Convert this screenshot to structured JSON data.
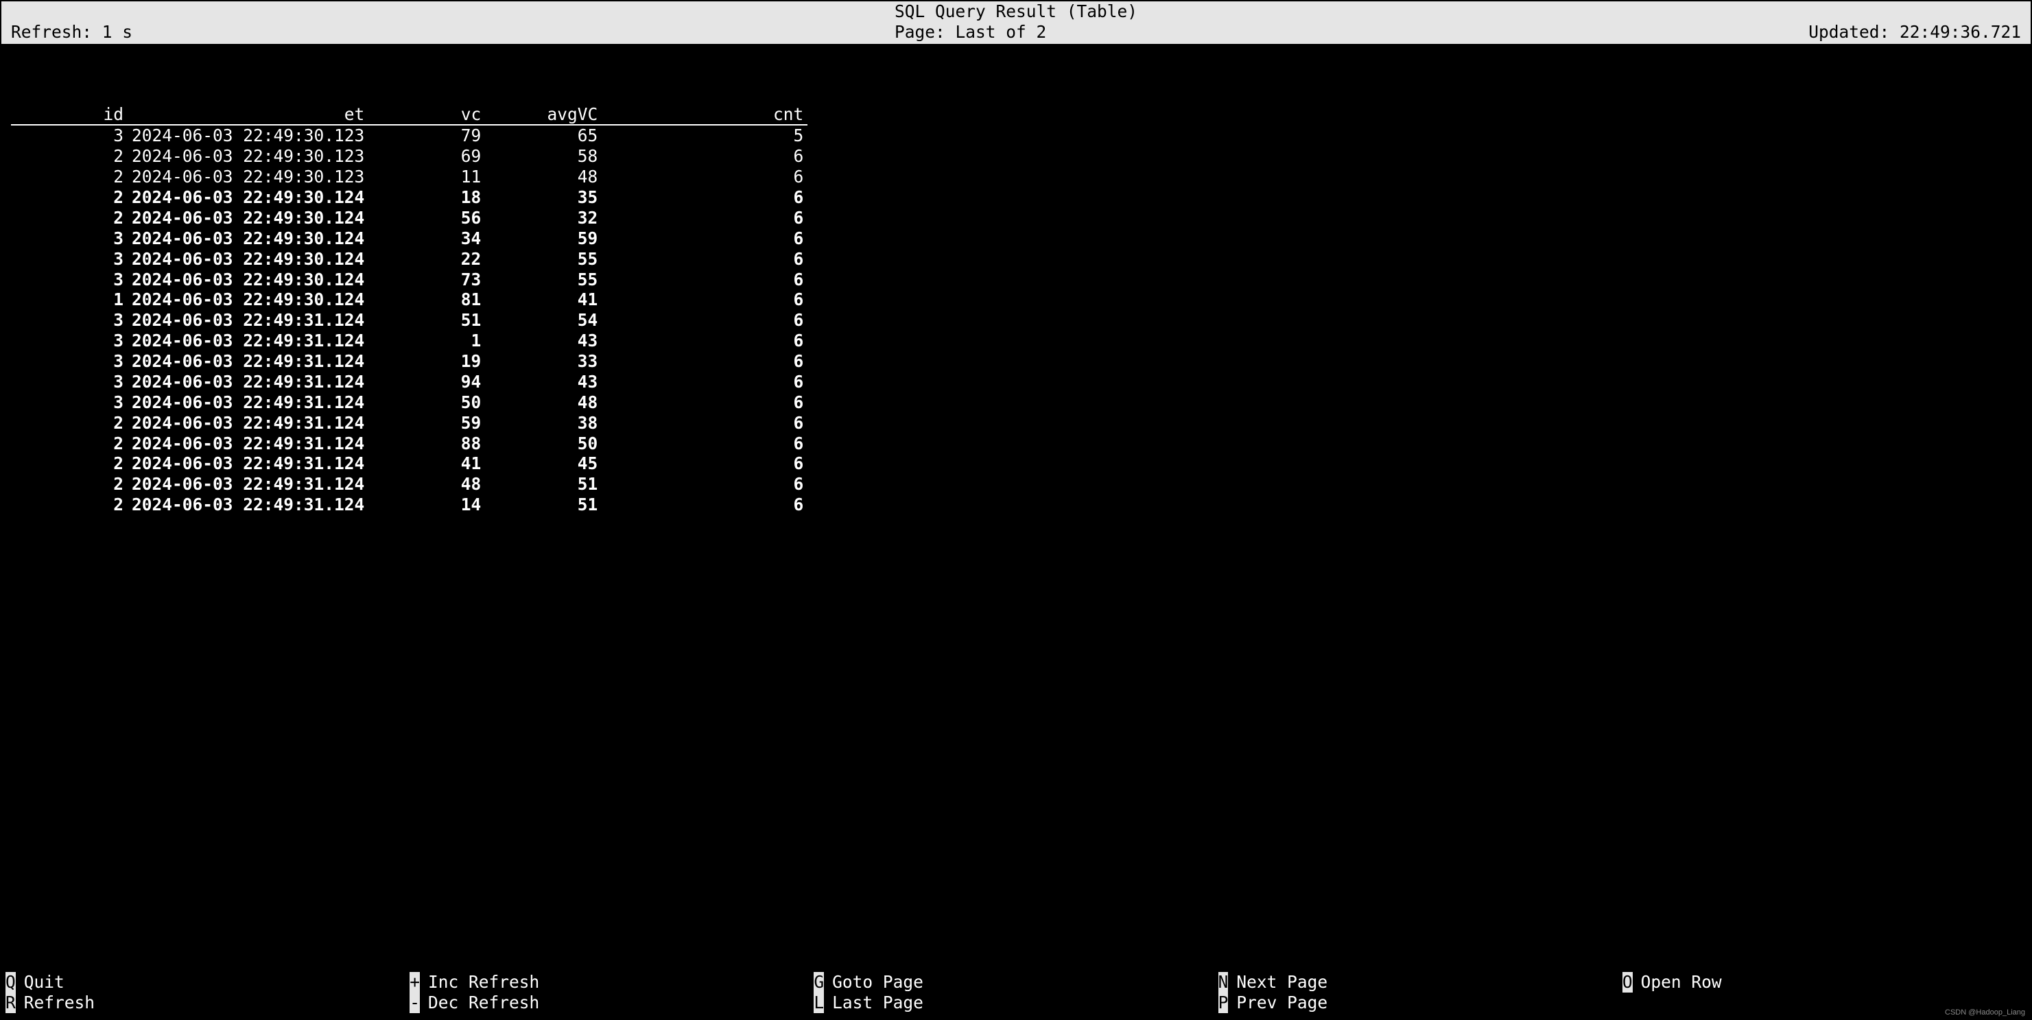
{
  "header": {
    "title": "SQL Query Result (Table)",
    "refresh_label": "Refresh: 1 s",
    "page_label": "Page: Last of 2",
    "updated_label": "Updated: 22:49:36.721"
  },
  "columns": [
    "id",
    "et",
    "vc",
    "avgVC",
    "cnt"
  ],
  "rows": [
    {
      "id": "3",
      "et": "2024-06-03 22:49:30.123",
      "vc": "79",
      "avg": "65",
      "cnt": "5",
      "bold": false
    },
    {
      "id": "2",
      "et": "2024-06-03 22:49:30.123",
      "vc": "69",
      "avg": "58",
      "cnt": "6",
      "bold": false
    },
    {
      "id": "2",
      "et": "2024-06-03 22:49:30.123",
      "vc": "11",
      "avg": "48",
      "cnt": "6",
      "bold": false
    },
    {
      "id": "2",
      "et": "2024-06-03 22:49:30.124",
      "vc": "18",
      "avg": "35",
      "cnt": "6",
      "bold": true
    },
    {
      "id": "2",
      "et": "2024-06-03 22:49:30.124",
      "vc": "56",
      "avg": "32",
      "cnt": "6",
      "bold": true
    },
    {
      "id": "3",
      "et": "2024-06-03 22:49:30.124",
      "vc": "34",
      "avg": "59",
      "cnt": "6",
      "bold": true
    },
    {
      "id": "3",
      "et": "2024-06-03 22:49:30.124",
      "vc": "22",
      "avg": "55",
      "cnt": "6",
      "bold": true
    },
    {
      "id": "3",
      "et": "2024-06-03 22:49:30.124",
      "vc": "73",
      "avg": "55",
      "cnt": "6",
      "bold": true
    },
    {
      "id": "1",
      "et": "2024-06-03 22:49:30.124",
      "vc": "81",
      "avg": "41",
      "cnt": "6",
      "bold": true
    },
    {
      "id": "3",
      "et": "2024-06-03 22:49:31.124",
      "vc": "51",
      "avg": "54",
      "cnt": "6",
      "bold": true
    },
    {
      "id": "3",
      "et": "2024-06-03 22:49:31.124",
      "vc": "1",
      "avg": "43",
      "cnt": "6",
      "bold": true
    },
    {
      "id": "3",
      "et": "2024-06-03 22:49:31.124",
      "vc": "19",
      "avg": "33",
      "cnt": "6",
      "bold": true
    },
    {
      "id": "3",
      "et": "2024-06-03 22:49:31.124",
      "vc": "94",
      "avg": "43",
      "cnt": "6",
      "bold": true
    },
    {
      "id": "3",
      "et": "2024-06-03 22:49:31.124",
      "vc": "50",
      "avg": "48",
      "cnt": "6",
      "bold": true
    },
    {
      "id": "2",
      "et": "2024-06-03 22:49:31.124",
      "vc": "59",
      "avg": "38",
      "cnt": "6",
      "bold": true
    },
    {
      "id": "2",
      "et": "2024-06-03 22:49:31.124",
      "vc": "88",
      "avg": "50",
      "cnt": "6",
      "bold": true
    },
    {
      "id": "2",
      "et": "2024-06-03 22:49:31.124",
      "vc": "41",
      "avg": "45",
      "cnt": "6",
      "bold": true
    },
    {
      "id": "2",
      "et": "2024-06-03 22:49:31.124",
      "vc": "48",
      "avg": "51",
      "cnt": "6",
      "bold": true
    },
    {
      "id": "2",
      "et": "2024-06-03 22:49:31.124",
      "vc": "14",
      "avg": "51",
      "cnt": "6",
      "bold": true
    }
  ],
  "footer": {
    "groups": [
      [
        {
          "key": "Q",
          "label": "Quit"
        },
        {
          "key": "R",
          "label": "Refresh"
        }
      ],
      [
        {
          "key": "+",
          "label": "Inc Refresh"
        },
        {
          "key": "-",
          "label": "Dec Refresh"
        }
      ],
      [
        {
          "key": "G",
          "label": "Goto Page"
        },
        {
          "key": "L",
          "label": "Last Page"
        }
      ],
      [
        {
          "key": "N",
          "label": "Next Page"
        },
        {
          "key": "P",
          "label": "Prev Page"
        }
      ],
      [
        {
          "key": "O",
          "label": "Open Row"
        }
      ]
    ]
  },
  "watermark": "CSDN @Hadoop_Liang",
  "chart_data": {
    "type": "table",
    "title": "SQL Query Result (Table)",
    "columns": [
      "id",
      "et",
      "vc",
      "avgVC",
      "cnt"
    ],
    "data": [
      [
        3,
        "2024-06-03 22:49:30.123",
        79,
        65,
        5
      ],
      [
        2,
        "2024-06-03 22:49:30.123",
        69,
        58,
        6
      ],
      [
        2,
        "2024-06-03 22:49:30.123",
        11,
        48,
        6
      ],
      [
        2,
        "2024-06-03 22:49:30.124",
        18,
        35,
        6
      ],
      [
        2,
        "2024-06-03 22:49:30.124",
        56,
        32,
        6
      ],
      [
        3,
        "2024-06-03 22:49:30.124",
        34,
        59,
        6
      ],
      [
        3,
        "2024-06-03 22:49:30.124",
        22,
        55,
        6
      ],
      [
        3,
        "2024-06-03 22:49:30.124",
        73,
        55,
        6
      ],
      [
        1,
        "2024-06-03 22:49:30.124",
        81,
        41,
        6
      ],
      [
        3,
        "2024-06-03 22:49:31.124",
        51,
        54,
        6
      ],
      [
        3,
        "2024-06-03 22:49:31.124",
        1,
        43,
        6
      ],
      [
        3,
        "2024-06-03 22:49:31.124",
        19,
        33,
        6
      ],
      [
        3,
        "2024-06-03 22:49:31.124",
        94,
        43,
        6
      ],
      [
        3,
        "2024-06-03 22:49:31.124",
        50,
        48,
        6
      ],
      [
        2,
        "2024-06-03 22:49:31.124",
        59,
        38,
        6
      ],
      [
        2,
        "2024-06-03 22:49:31.124",
        88,
        50,
        6
      ],
      [
        2,
        "2024-06-03 22:49:31.124",
        41,
        45,
        6
      ],
      [
        2,
        "2024-06-03 22:49:31.124",
        48,
        51,
        6
      ],
      [
        2,
        "2024-06-03 22:49:31.124",
        14,
        51,
        6
      ]
    ]
  }
}
